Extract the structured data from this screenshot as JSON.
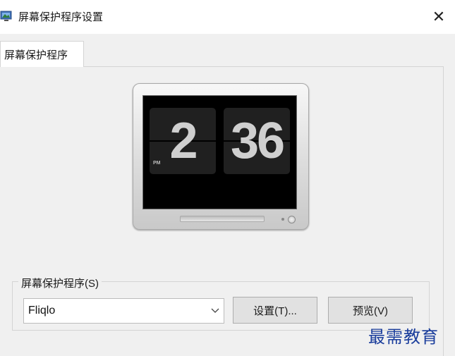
{
  "window": {
    "title": "屏幕保护程序设置",
    "close_glyph": "✕",
    "icon": "screen-saver-settings-icon"
  },
  "tabs": [
    {
      "label": "屏幕保护程序",
      "active": true
    }
  ],
  "preview": {
    "hour": "2",
    "minute": "36",
    "ampm": "PM"
  },
  "screensaver_group": {
    "label": "屏幕保护程序(S)",
    "selected": "Fliqlo",
    "settings_button": "设置(T)...",
    "preview_button": "预览(V)"
  },
  "watermark": "最需教育",
  "colors": {
    "dialog_bg": "#f0f0f0",
    "watermark": "#1a3d9c"
  }
}
